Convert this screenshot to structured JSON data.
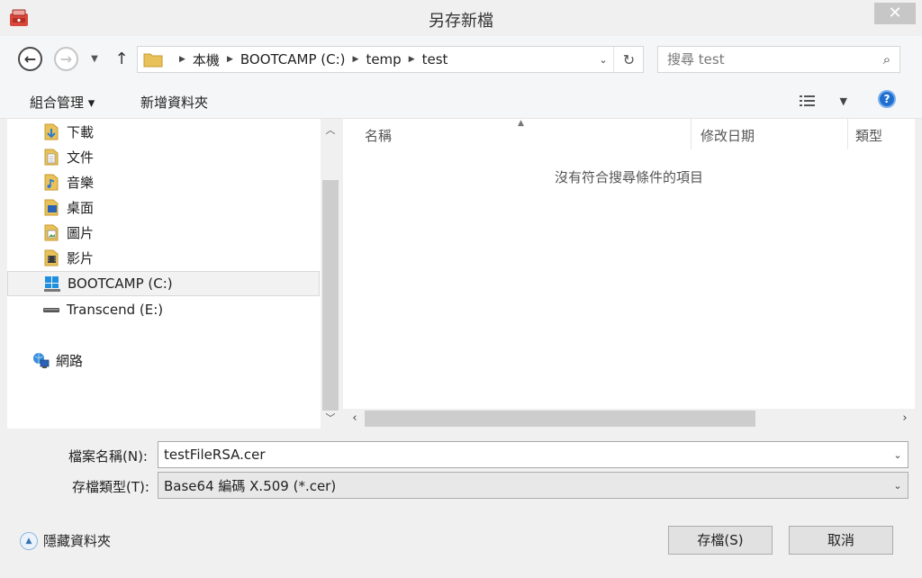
{
  "window": {
    "title": "另存新檔",
    "close_label": "✕"
  },
  "nav": {
    "crumbs": [
      "本機",
      "BOOTCAMP (C:)",
      "temp",
      "test"
    ],
    "search_placeholder": "搜尋 test"
  },
  "toolbar": {
    "organize_label": "組合管理 ▾",
    "new_folder_label": "新增資料夾",
    "help_label": "?"
  },
  "sidebar": {
    "items": [
      {
        "label": "下載",
        "icon": "downloads-folder-icon"
      },
      {
        "label": "文件",
        "icon": "documents-folder-icon"
      },
      {
        "label": "音樂",
        "icon": "music-folder-icon"
      },
      {
        "label": "桌面",
        "icon": "desktop-folder-icon"
      },
      {
        "label": "圖片",
        "icon": "pictures-folder-icon"
      },
      {
        "label": "影片",
        "icon": "videos-folder-icon"
      },
      {
        "label": "BOOTCAMP (C:)",
        "icon": "windows-drive-icon",
        "selected": true
      },
      {
        "label": "Transcend (E:)",
        "icon": "removable-drive-icon"
      },
      {
        "label": "網路",
        "icon": "network-icon"
      }
    ]
  },
  "filelist": {
    "columns": [
      "名稱",
      "修改日期",
      "類型"
    ],
    "empty_message": "沒有符合搜尋條件的項目"
  },
  "form": {
    "filename_label": "檔案名稱(N):",
    "filename_value": "testFileRSA.cer",
    "filetype_label": "存檔類型(T):",
    "filetype_value": "Base64 編碼 X.509 (*.cer)"
  },
  "footer": {
    "hide_folders_label": "隱藏資料夾",
    "save_label": "存檔(S)",
    "cancel_label": "取消"
  },
  "colors": {
    "help_blue": "#1f6fd1",
    "folder_yellow": "#e8c15a",
    "selection_border": "#d9d9d9"
  }
}
